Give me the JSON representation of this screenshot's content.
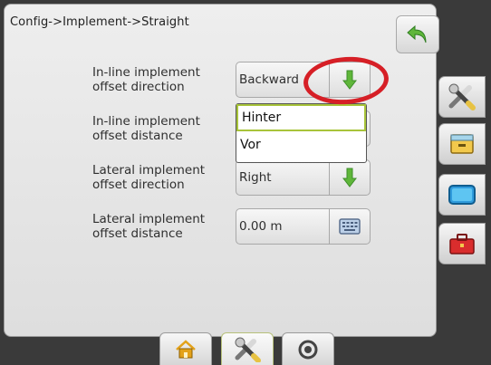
{
  "breadcrumb": "Config->Implement->Straight",
  "rows": [
    {
      "label_line1": "In-line implement",
      "label_line2": "offset direction",
      "value": "Backward"
    },
    {
      "label_line1": "In-line implement",
      "label_line2": "offset distance",
      "value": ""
    },
    {
      "label_line1": "Lateral implement",
      "label_line2": "offset direction",
      "value": "Right"
    },
    {
      "label_line1": "Lateral implement",
      "label_line2": "offset distance",
      "value": "0.00 m"
    }
  ],
  "dropdown": {
    "options": [
      "Hinter",
      "Vor"
    ],
    "selected": "Hinter"
  },
  "icons": {
    "back": "back-arrow-icon",
    "down": "green-down-arrow-icon",
    "keyboard": "keyboard-icon",
    "side": [
      "tools-icon",
      "drawer-icon",
      "screen-icon",
      "toolbox-icon"
    ],
    "bottom": [
      "home-icon",
      "tools-icon",
      "camera-icon"
    ]
  },
  "colors": {
    "accent_green": "#5fb63a",
    "highlight_red": "#d61f26",
    "selection_outline": "#a8c43a"
  }
}
